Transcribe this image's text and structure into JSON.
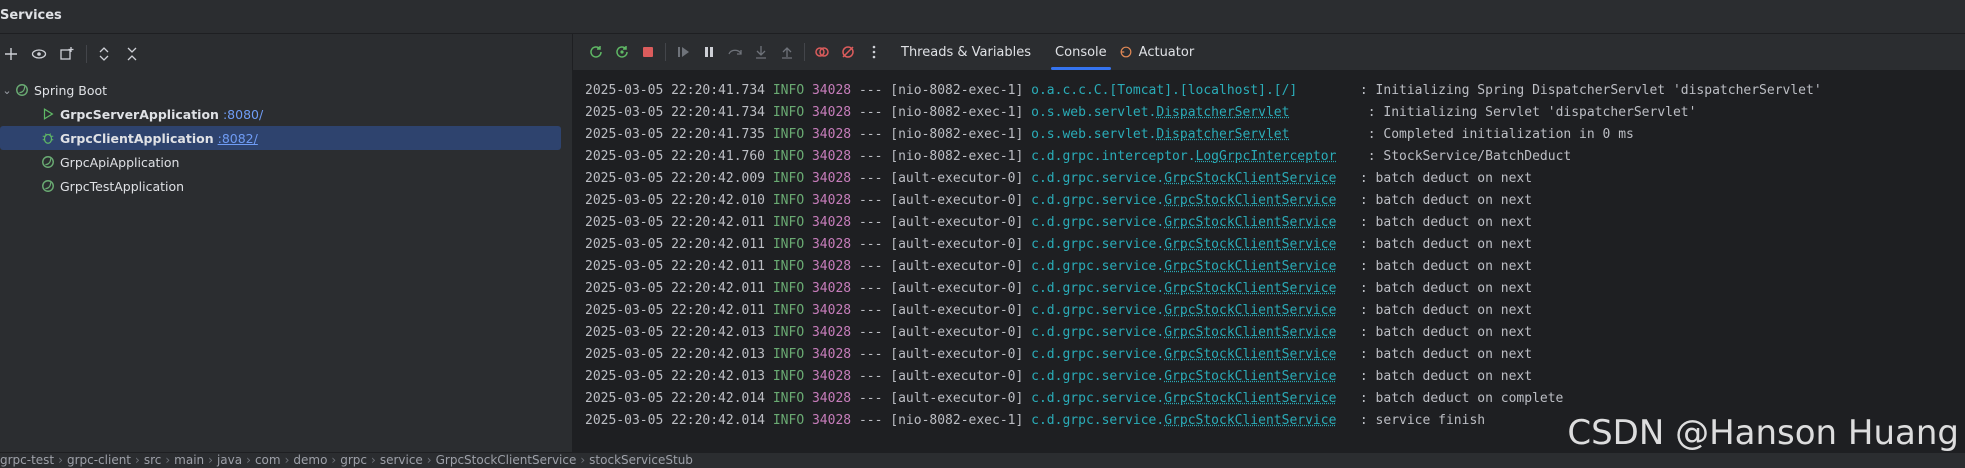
{
  "titlebar": {
    "title": "Services"
  },
  "left_toolbar": {
    "icons": [
      "add-icon",
      "eye-icon",
      "new-window-icon",
      "expand-all-icon",
      "collapse-all-icon"
    ]
  },
  "tree": {
    "group": "Spring Boot",
    "items": [
      {
        "name": "GrpcServerApplication",
        "port": ":8080/",
        "bold": true,
        "running": true,
        "selected": false
      },
      {
        "name": "GrpcClientApplication",
        "port": ":8082/",
        "bold": true,
        "running": true,
        "selected": true
      },
      {
        "name": "GrpcApiApplication",
        "port": "",
        "bold": false,
        "running": false,
        "selected": false
      },
      {
        "name": "GrpcTestApplication",
        "port": "",
        "bold": false,
        "running": false,
        "selected": false
      }
    ]
  },
  "right_toolbar": {
    "tabs": [
      "Threads & Variables",
      "Console",
      "Actuator"
    ],
    "active_tab": "Console"
  },
  "console": {
    "lines": [
      {
        "ts": "2025-03-05 22:20:41.734",
        "lvl": "INFO",
        "pid": "34028",
        "thread": "[nio-8082-exec-1]",
        "pkg": "o.a.c.c.C.[Tomcat].[localhost].[/]",
        "cls": "",
        "pad": "       ",
        "msg": ": Initializing Spring DispatcherServlet 'dispatcherServlet'"
      },
      {
        "ts": "2025-03-05 22:20:41.734",
        "lvl": "INFO",
        "pid": "34028",
        "thread": "[nio-8082-exec-1]",
        "pkg": "o.s.web.servlet.",
        "cls": "DispatcherServlet",
        "pad": "         ",
        "msg": ": Initializing Servlet 'dispatcherServlet'"
      },
      {
        "ts": "2025-03-05 22:20:41.735",
        "lvl": "INFO",
        "pid": "34028",
        "thread": "[nio-8082-exec-1]",
        "pkg": "o.s.web.servlet.",
        "cls": "DispatcherServlet",
        "pad": "         ",
        "msg": ": Completed initialization in 0 ms"
      },
      {
        "ts": "2025-03-05 22:20:41.760",
        "lvl": "INFO",
        "pid": "34028",
        "thread": "[nio-8082-exec-1]",
        "pkg": "c.d.grpc.interceptor.",
        "cls": "LogGrpcInterceptor",
        "pad": "   ",
        "msg": ": StockService/BatchDeduct"
      },
      {
        "ts": "2025-03-05 22:20:42.009",
        "lvl": "INFO",
        "pid": "34028",
        "thread": "[ault-executor-0]",
        "pkg": "c.d.grpc.service.",
        "cls": "GrpcStockClientService",
        "pad": "  ",
        "msg": ": batch deduct on next"
      },
      {
        "ts": "2025-03-05 22:20:42.010",
        "lvl": "INFO",
        "pid": "34028",
        "thread": "[ault-executor-0]",
        "pkg": "c.d.grpc.service.",
        "cls": "GrpcStockClientService",
        "pad": "  ",
        "msg": ": batch deduct on next"
      },
      {
        "ts": "2025-03-05 22:20:42.011",
        "lvl": "INFO",
        "pid": "34028",
        "thread": "[ault-executor-0]",
        "pkg": "c.d.grpc.service.",
        "cls": "GrpcStockClientService",
        "pad": "  ",
        "msg": ": batch deduct on next"
      },
      {
        "ts": "2025-03-05 22:20:42.011",
        "lvl": "INFO",
        "pid": "34028",
        "thread": "[ault-executor-0]",
        "pkg": "c.d.grpc.service.",
        "cls": "GrpcStockClientService",
        "pad": "  ",
        "msg": ": batch deduct on next"
      },
      {
        "ts": "2025-03-05 22:20:42.011",
        "lvl": "INFO",
        "pid": "34028",
        "thread": "[ault-executor-0]",
        "pkg": "c.d.grpc.service.",
        "cls": "GrpcStockClientService",
        "pad": "  ",
        "msg": ": batch deduct on next"
      },
      {
        "ts": "2025-03-05 22:20:42.011",
        "lvl": "INFO",
        "pid": "34028",
        "thread": "[ault-executor-0]",
        "pkg": "c.d.grpc.service.",
        "cls": "GrpcStockClientService",
        "pad": "  ",
        "msg": ": batch deduct on next"
      },
      {
        "ts": "2025-03-05 22:20:42.011",
        "lvl": "INFO",
        "pid": "34028",
        "thread": "[ault-executor-0]",
        "pkg": "c.d.grpc.service.",
        "cls": "GrpcStockClientService",
        "pad": "  ",
        "msg": ": batch deduct on next"
      },
      {
        "ts": "2025-03-05 22:20:42.013",
        "lvl": "INFO",
        "pid": "34028",
        "thread": "[ault-executor-0]",
        "pkg": "c.d.grpc.service.",
        "cls": "GrpcStockClientService",
        "pad": "  ",
        "msg": ": batch deduct on next"
      },
      {
        "ts": "2025-03-05 22:20:42.013",
        "lvl": "INFO",
        "pid": "34028",
        "thread": "[ault-executor-0]",
        "pkg": "c.d.grpc.service.",
        "cls": "GrpcStockClientService",
        "pad": "  ",
        "msg": ": batch deduct on next"
      },
      {
        "ts": "2025-03-05 22:20:42.013",
        "lvl": "INFO",
        "pid": "34028",
        "thread": "[ault-executor-0]",
        "pkg": "c.d.grpc.service.",
        "cls": "GrpcStockClientService",
        "pad": "  ",
        "msg": ": batch deduct on next"
      },
      {
        "ts": "2025-03-05 22:20:42.014",
        "lvl": "INFO",
        "pid": "34028",
        "thread": "[ault-executor-0]",
        "pkg": "c.d.grpc.service.",
        "cls": "GrpcStockClientService",
        "pad": "  ",
        "msg": ": batch deduct on complete"
      },
      {
        "ts": "2025-03-05 22:20:42.014",
        "lvl": "INFO",
        "pid": "34028",
        "thread": "[nio-8082-exec-1]",
        "pkg": "c.d.grpc.service.",
        "cls": "GrpcStockClientService",
        "pad": "  ",
        "msg": ": service finish"
      }
    ]
  },
  "watermark": "CSDN @Hanson Huang",
  "statusbar": {
    "crumbs": [
      "grpc-test",
      "grpc-client",
      "src",
      "main",
      "java",
      "com",
      "demo",
      "grpc",
      "service",
      "GrpcStockClientService",
      "stockServiceStub"
    ]
  },
  "colors": {
    "accent": "#3574f0",
    "selection": "#2e436e",
    "info_level": "#6aab73",
    "pid": "#c77dbb",
    "logger": "#2aacb8",
    "running": "#5fb865",
    "stop": "#db5c5c"
  }
}
